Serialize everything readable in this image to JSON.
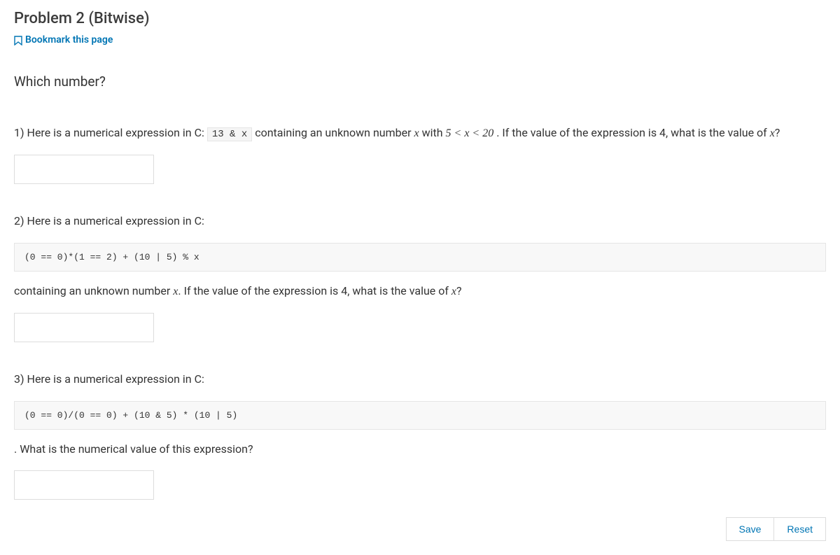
{
  "header": {
    "title": "Problem 2 (Bitwise)",
    "bookmark_label": "Bookmark this page"
  },
  "section_heading": "Which number?",
  "q1": {
    "prefix": "1) Here is a numerical expression in C: ",
    "code": "13 & x",
    "mid1": " containing an unknown number ",
    "var1": "x",
    "mid2": " with ",
    "range": "5 < x < 20",
    "mid3": " . If the value of the expression is ",
    "val": "4",
    "mid4": ", what is the value of ",
    "var2": "x",
    "suffix": "?"
  },
  "q2": {
    "intro": "2) Here is a numerical expression in C:",
    "code": "(0 == 0)*(1 == 2) + (10 | 5) %  x",
    "follow_prefix": "containing an unknown number ",
    "var1": "x",
    "follow_mid1": ". If the value of the expression is ",
    "val": "4",
    "follow_mid2": ", what is the value of ",
    "var2": "x",
    "follow_suffix": "?"
  },
  "q3": {
    "intro": "3) Here is a numerical expression in C:",
    "code": "(0 == 0)/(0 == 0) + (10 & 5) * (10 | 5)",
    "follow": ". What is the numerical value of this expression?"
  },
  "buttons": {
    "save": "Save",
    "reset": "Reset"
  }
}
